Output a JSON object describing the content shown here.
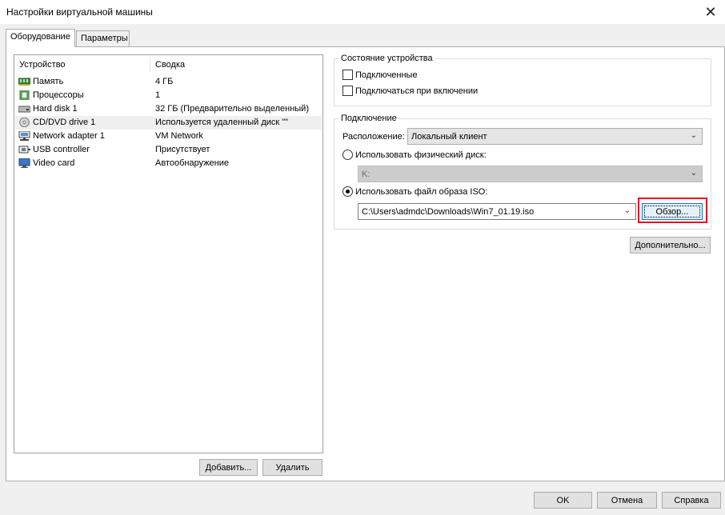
{
  "window": {
    "title": "Настройки виртуальной машины",
    "close_glyph": "✕"
  },
  "tabs": [
    {
      "label": "Оборудование"
    },
    {
      "label": "Параметры"
    }
  ],
  "device_list": {
    "col_device": "Устройство",
    "col_summary": "Сводка",
    "rows": [
      {
        "device": "Память",
        "summary": "4 ГБ",
        "icon": "memory-icon"
      },
      {
        "device": "Процессоры",
        "summary": "1",
        "icon": "cpu-icon"
      },
      {
        "device": "Hard disk 1",
        "summary": "32 ГБ (Предварительно выделенный)",
        "icon": "hard-disk-icon"
      },
      {
        "device": "CD/DVD drive 1",
        "summary": "Используется удаленный диск \"\"",
        "icon": "cd-dvd-icon"
      },
      {
        "device": "Network adapter 1",
        "summary": "VM Network",
        "icon": "network-adapter-icon"
      },
      {
        "device": "USB controller",
        "summary": "Присутствует",
        "icon": "usb-controller-icon"
      },
      {
        "device": "Video card",
        "summary": "Автообнаружение",
        "icon": "monitor-icon"
      }
    ],
    "selected_index": 3
  },
  "list_buttons": {
    "add": "Добавить...",
    "remove": "Удалить"
  },
  "device_status": {
    "title": "Состояние устройства",
    "connected": "Подключенные",
    "connect_at_power_on": "Подключаться при включении"
  },
  "connection": {
    "title": "Подключение",
    "location_label": "Расположение:",
    "location_value": "Локальный клиент",
    "physical_label": "Использовать физический диск:",
    "physical_value": "K:",
    "iso_label": "Использовать файл образа ISO:",
    "iso_path": "C:\\Users\\admdc\\Downloads\\Win7_01.19.iso",
    "browse": "Обзор..."
  },
  "advanced_button": "Дополнительно...",
  "footer": {
    "ok": "OK",
    "cancel": "Отмена",
    "help": "Справка"
  },
  "colors": {
    "highlight": "#e81123",
    "focus_border": "#0078d7"
  }
}
